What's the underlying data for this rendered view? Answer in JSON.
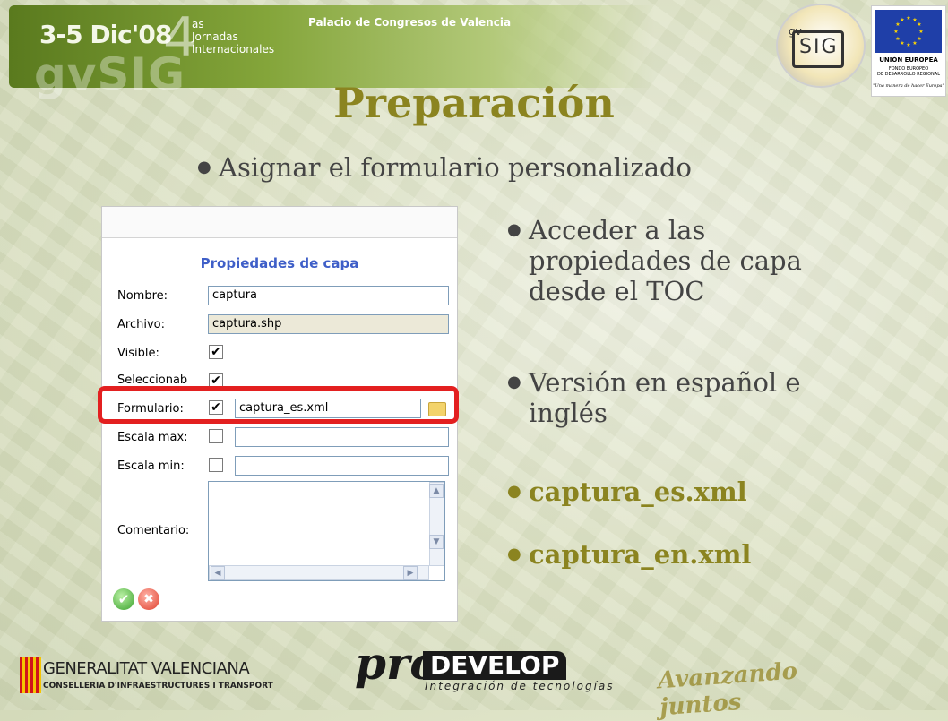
{
  "header": {
    "event_date": "3-5 Dic'08",
    "event_number": "4",
    "event_name_lines": [
      "as",
      "Jornadas",
      "Internacionales"
    ],
    "event_brand": "gvSIG",
    "venue": "Palacio de Congresos de Valencia"
  },
  "logos": {
    "gvsig_small": "gv",
    "gvsig_big": "SIG",
    "eu_union": "UNIÓN EUROPEA",
    "eu_fund_line1": "FONDO EUROPEO",
    "eu_fund_line2": "DE DESARROLLO REGIONAL",
    "eu_motto": "\"Una manera de hacer Europa\""
  },
  "slide": {
    "title": "Preparación",
    "bullets": {
      "main": "Asignar el formulario personalizado",
      "access_line1": "Acceder a las",
      "access_line2": "propiedades de capa",
      "access_line3": "desde el TOC",
      "version_line1": "Versión en español e",
      "version_line2": "inglés",
      "file_es": "captura_es.xml",
      "file_en": "captura_en.xml"
    },
    "bullet_color": "#444444",
    "accent_color": "#8b8420"
  },
  "dialog": {
    "title": "Propiedades de capa",
    "labels": {
      "nombre": "Nombre:",
      "archivo": "Archivo:",
      "visible": "Visible:",
      "seleccionable": "Seleccionab",
      "formulario": "Formulario:",
      "escala_max": "Escala max:",
      "escala_min": "Escala min:",
      "comentario": "Comentario:"
    },
    "values": {
      "nombre": "captura",
      "archivo": "captura.shp",
      "formulario": "captura_es.xml",
      "escala_max": "",
      "escala_min": "",
      "comentario": ""
    },
    "checks": {
      "visible": "✔",
      "seleccionable": "✔",
      "formulario": "✔",
      "escala_max": "",
      "escala_min": ""
    },
    "ok_glyph": "✔",
    "cancel_glyph": "✖",
    "highlight_color": "#e32020"
  },
  "footer": {
    "gv_name": "GENERALITAT VALENCIANA",
    "gv_sub": "CONSELLERIA D'INFRAESTRUCTURES I TRANSPORT",
    "pro": "pro",
    "develop": "DEVELOP",
    "integracion": "Integración de tecnologías",
    "slogan": "Avanzando juntos"
  }
}
